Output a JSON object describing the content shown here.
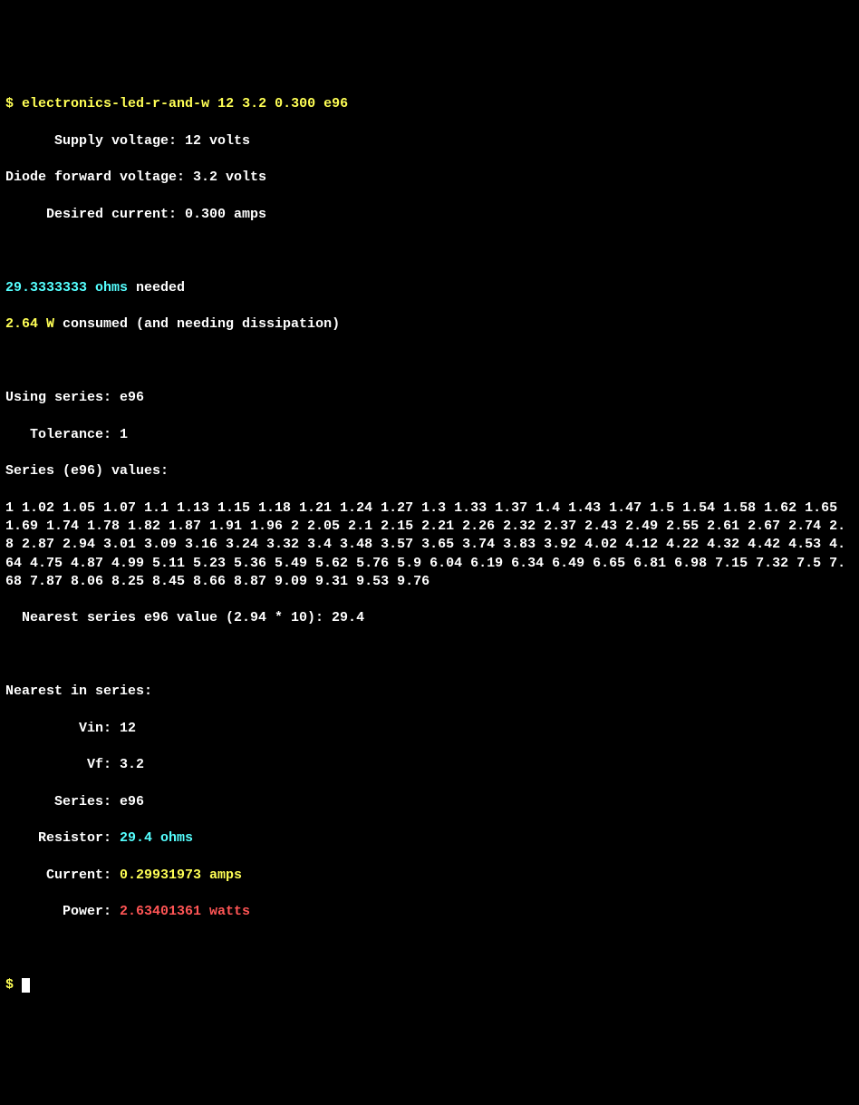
{
  "prompt_symbol": "$",
  "command": "electronics-led-r-and-w 12 3.2 0.300 e96",
  "inputs": {
    "supply_voltage_label": "      Supply voltage: ",
    "supply_voltage_value": "12 volts",
    "diode_fv_label": "Diode forward voltage: ",
    "diode_fv_value": "3.2 volts",
    "desired_current_label": "     Desired current: ",
    "desired_current_value": "0.300 amps"
  },
  "primary_results": {
    "ohms_value": "29.3333333 ohms",
    "ohms_suffix": " needed",
    "watts_value": "2.64 W",
    "watts_suffix": " consumed (and needing dissipation)"
  },
  "series": {
    "using_line": "Using series: e96",
    "tolerance_line": "   Tolerance: 1",
    "values_header": "Series (e96) values:",
    "values_body": "  1 1.02 1.05 1.07 1.1 1.13 1.15 1.18 1.21 1.24 1.27 1.3 1.33 1.37 1.4 1.43 1.47 1.5 1.54 1.58 1.62 1.65 1.69 1.74 1.78 1.82 1.87 1.91 1.96 2 2.05 2.1 2.15 2.21 2.26 2.32 2.37 2.43 2.49 2.55 2.61 2.67 2.74 2.8 2.87 2.94 3.01 3.09 3.16 3.24 3.32 3.4 3.48 3.57 3.65 3.74 3.83 3.92 4.02 4.12 4.22 4.32 4.42 4.53 4.64 4.75 4.87 4.99 5.11 5.23 5.36 5.49 5.62 5.76 5.9 6.04 6.19 6.34 6.49 6.65 6.81 6.98 7.15 7.32 7.5 7.68 7.87 8.06 8.25 8.45 8.66 8.87 9.09 9.31 9.53 9.76",
    "nearest_line": "  Nearest series e96 value (2.94 * 10): 29.4"
  },
  "nearest_block": {
    "header": "Nearest in series:",
    "vin_label": "         Vin: ",
    "vin_value": "12",
    "vf_label": "          Vf: ",
    "vf_value": "3.2",
    "series_label": "      Series: ",
    "series_value": "e96",
    "resistor_label": "    Resistor: ",
    "resistor_value": "29.4 ohms",
    "current_label": "     Current: ",
    "current_value": "0.29931973 amps",
    "power_label": "       Power: ",
    "power_value": "2.63401361 watts"
  }
}
